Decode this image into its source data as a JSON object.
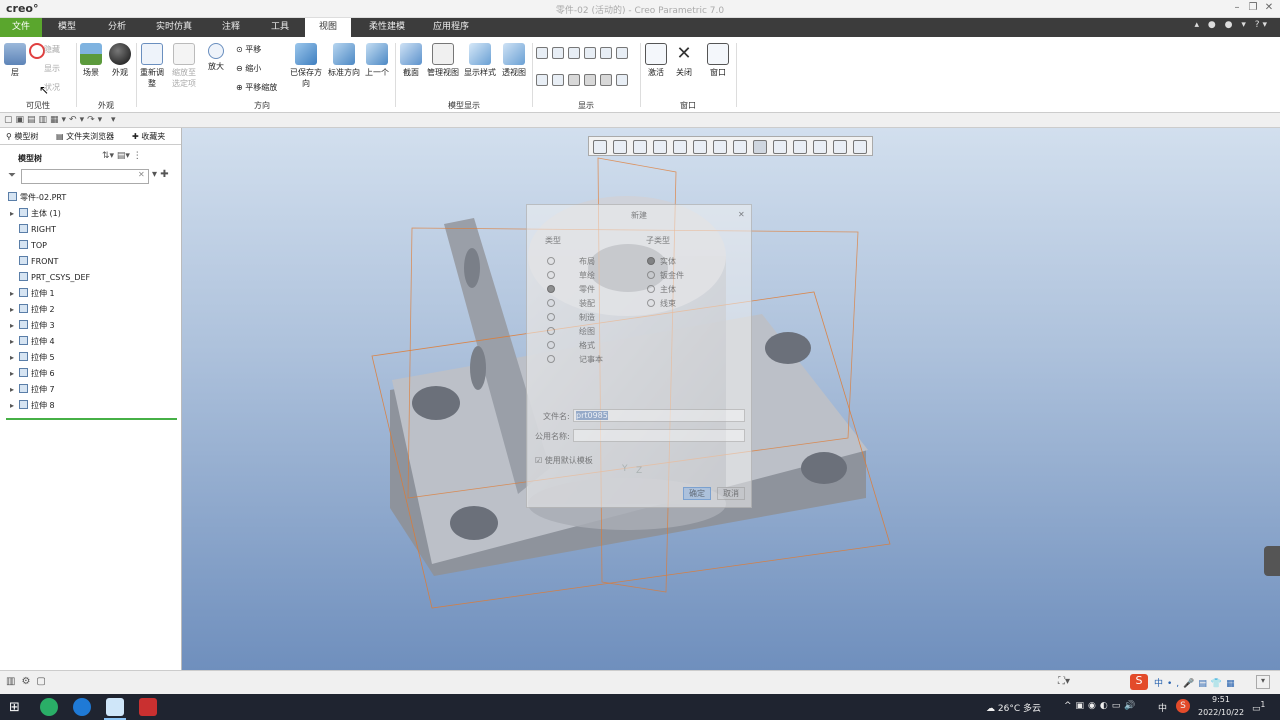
{
  "app": {
    "logo": "creo°",
    "title": "零件-02 (活动的) - Creo Parametric 7.0"
  },
  "tabs": [
    "文件",
    "模型",
    "分析",
    "实时仿真",
    "注释",
    "工具",
    "视图",
    "柔性建模",
    "应用程序"
  ],
  "ribbon": {
    "layer": "层",
    "hide": "隐藏",
    "show": "显示",
    "status": "状况",
    "visibility_group": "可见性",
    "scene": "场景",
    "appearance": "外观",
    "appearance_group": "外观",
    "refit": "重新调整",
    "zoom_selected": "缩放至选定项",
    "zoom_in": "放大",
    "pan": "平移",
    "zoom_out": "缩小",
    "pan_zoom": "平移缩放",
    "orientation_group": "方向",
    "saved_orient": "已保存方向",
    "std_orient": "标准方向",
    "prev": "上一个",
    "section": "截面",
    "manage_views": "管理视图",
    "display_style": "显示样式",
    "perspective": "透视图",
    "model_display_group": "模型显示",
    "show_group": "显示",
    "activate": "激活",
    "close": "关闭",
    "window": "窗口",
    "window_group": "窗口"
  },
  "panel": {
    "tabs": [
      "模型树",
      "文件夹浏览器",
      "收藏夹"
    ],
    "heading": "模型树",
    "search_placeholder": "",
    "items": [
      {
        "label": "零件-02.PRT",
        "indent": 0,
        "arrow": ""
      },
      {
        "label": "主体 (1)",
        "indent": 1,
        "arrow": "▸"
      },
      {
        "label": "RIGHT",
        "indent": 1,
        "arrow": ""
      },
      {
        "label": "TOP",
        "indent": 1,
        "arrow": ""
      },
      {
        "label": "FRONT",
        "indent": 1,
        "arrow": ""
      },
      {
        "label": "PRT_CSYS_DEF",
        "indent": 1,
        "arrow": ""
      },
      {
        "label": "拉伸 1",
        "indent": 1,
        "arrow": "▸"
      },
      {
        "label": "拉伸 2",
        "indent": 1,
        "arrow": "▸"
      },
      {
        "label": "拉伸 3",
        "indent": 1,
        "arrow": "▸"
      },
      {
        "label": "拉伸 4",
        "indent": 1,
        "arrow": "▸"
      },
      {
        "label": "拉伸 5",
        "indent": 1,
        "arrow": "▸"
      },
      {
        "label": "拉伸 6",
        "indent": 1,
        "arrow": "▸"
      },
      {
        "label": "拉伸 7",
        "indent": 1,
        "arrow": "▸"
      },
      {
        "label": "拉伸 8",
        "indent": 1,
        "arrow": "▸"
      }
    ]
  },
  "dialog": {
    "title": "新建",
    "type_label": "类型",
    "subtype_label": "子类型",
    "types": [
      "布局",
      "草绘",
      "零件",
      "装配",
      "制造",
      "绘图",
      "格式",
      "记事本"
    ],
    "selected_type_index": 2,
    "subtypes": [
      "实体",
      "钣金件",
      "主体",
      "线束"
    ],
    "selected_subtype_index": 0,
    "filename_label": "文件名:",
    "filename_value": "prt0985",
    "common_name_label": "公用名称:",
    "common_name_value": "",
    "use_template": "使用默认模板",
    "ok": "确定",
    "cancel": "取消"
  },
  "viewport": {
    "axis_y": "Y",
    "axis_z": "Z"
  },
  "taskbar": {
    "weather": "26°C 多云",
    "ime": "中",
    "time": "9:51",
    "date": "2022/10/22",
    "notif": "1"
  },
  "colors": {
    "accent_green": "#5aa62d",
    "tab_bar": "#3c3c3c",
    "datum_orange": "#e07a30"
  }
}
